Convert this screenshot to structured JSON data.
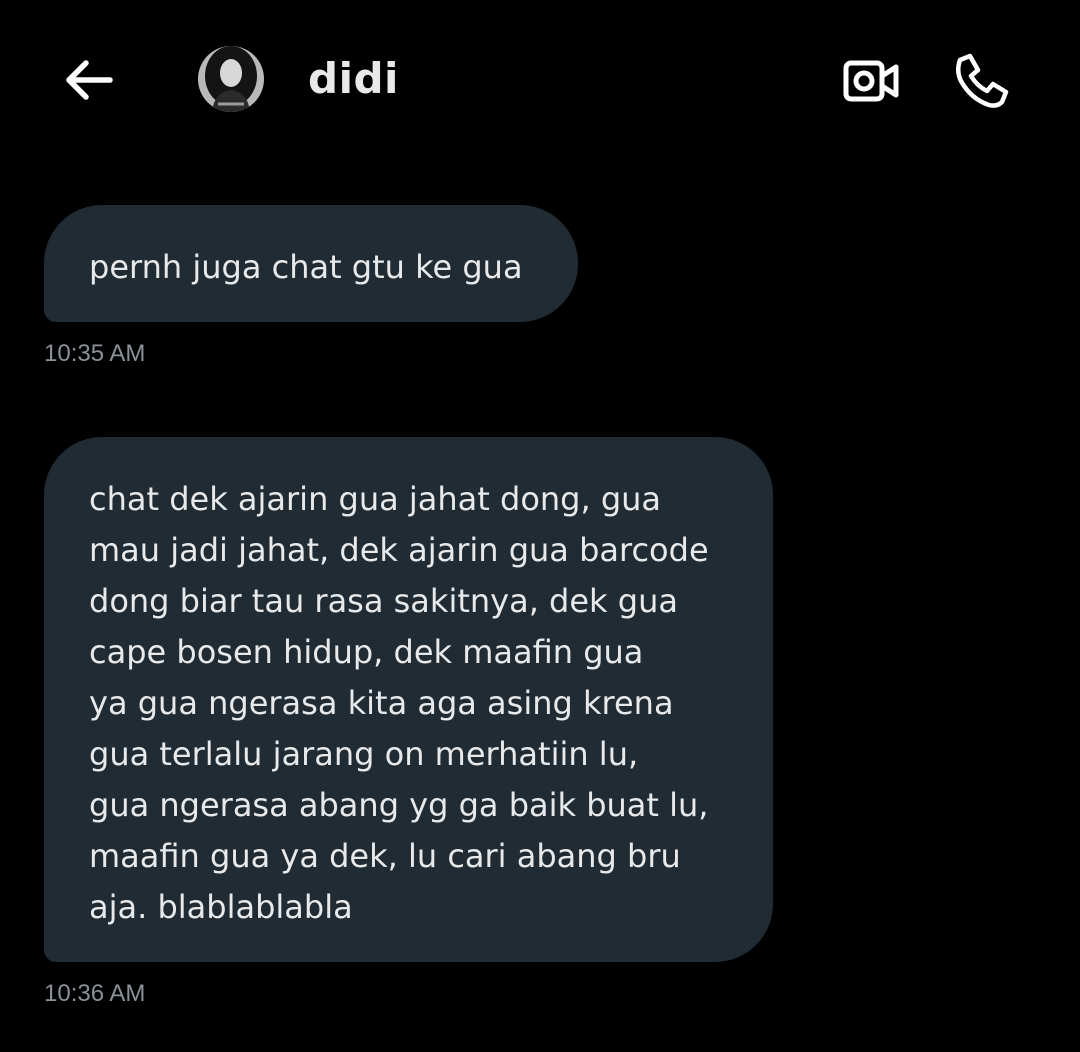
{
  "header": {
    "contact_name": "didi",
    "back_icon": "arrow-left-icon",
    "video_icon": "video-camera-icon",
    "call_icon": "phone-icon",
    "avatar": "profile-photo"
  },
  "messages": [
    {
      "lines": [
        "pernh juga chat gtu ke gua"
      ],
      "time": "10:35 AM"
    },
    {
      "lines": [
        "chat dek ajarin gua jahat dong, gua",
        "mau jadi jahat, dek ajarin gua barcode",
        "dong biar tau rasa sakitnya, dek gua",
        "cape bosen hidup, dek maafin gua",
        "ya gua ngerasa kita aga asing krena",
        "gua terlalu jarang on merhatiin lu,",
        "gua ngerasa abang yg ga baik buat lu,",
        "maafin gua ya dek, lu cari abang bru",
        "aja. blablablabla"
      ],
      "time": "10:36 AM"
    }
  ],
  "colors": {
    "background": "#000000",
    "bubble": "#202b33",
    "text": "#e7e9ea",
    "timestamp": "#8b9196"
  }
}
